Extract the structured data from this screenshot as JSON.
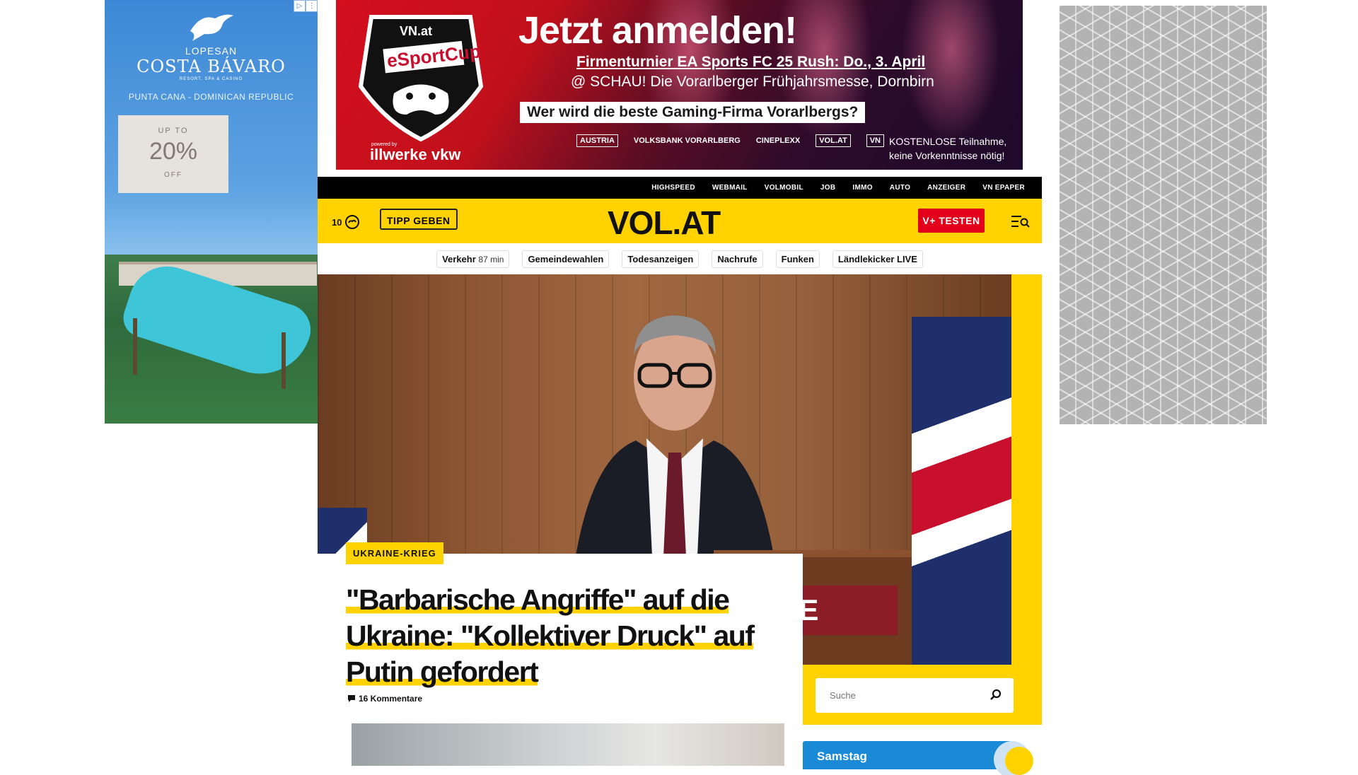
{
  "ad_left": {
    "brand_small": "LOPESAN",
    "brand_big": "COSTA BÁVARO",
    "brand_sub": "RESORT, SPA & CASINO",
    "location": "PUNTA CANA - DOMINICAN REPUBLIC",
    "offer_top": "UP TO",
    "offer_value": "20%",
    "offer_bottom": "OFF",
    "choices_play": "▷",
    "choices_menu": "⋮"
  },
  "banner": {
    "shield_top": "VN.at",
    "shield_name": "eSportCup",
    "powered": "powered by",
    "sponsors": "illwerke vkw",
    "title": "Jetzt anmelden!",
    "line1": "Firmenturnier EA Sports FC 25 Rush: Do., 3. April",
    "line2": "@ SCHAU! Die Vorarlberger Frühjahrsmesse, Dornbirn",
    "question": "Wer wird die beste Gaming-Firma Vorarlbergs?",
    "logos": [
      "AUSTRIA",
      "VOLKSBANK VORARLBERG",
      "CINEPLEXX",
      "VOL.AT",
      "VN"
    ],
    "free_line1": "KOSTENLOSE Teilnahme,",
    "free_line2": "keine Vorkenntnisse nötig!"
  },
  "topnav": [
    "HIGHSPEED",
    "WEBMAIL",
    "VOLMOBIL",
    "JOB",
    "IMMO",
    "AUTO",
    "ANZEIGER",
    "VN EPAPER"
  ],
  "header": {
    "temperature": "10",
    "tipp_label": "TIPP GEBEN",
    "logo": "VOL.AT",
    "vplus_label": "V+ TESTEN"
  },
  "quicklinks": {
    "traffic_label": "Verkehr",
    "traffic_delay": "87 min",
    "items": [
      "Gemeindewahlen",
      "Todesanzeigen",
      "Nachrufe",
      "Funken",
      "Ländlekicker LIVE"
    ]
  },
  "hero": {
    "lectern_text": "RE",
    "tag": "UKRAINE-KRIEG",
    "headline": "\"Barbarische Angriffe\" auf die Ukraine: \"Kollektiver Druck\" auf Putin gefordert",
    "comments": "16 Kommentare"
  },
  "search": {
    "placeholder": "Suche"
  },
  "weather": {
    "day": "Samstag"
  },
  "colors": {
    "brand_yellow": "#ffd200",
    "accent_red": "#e3001b",
    "nav_black": "#000000"
  }
}
